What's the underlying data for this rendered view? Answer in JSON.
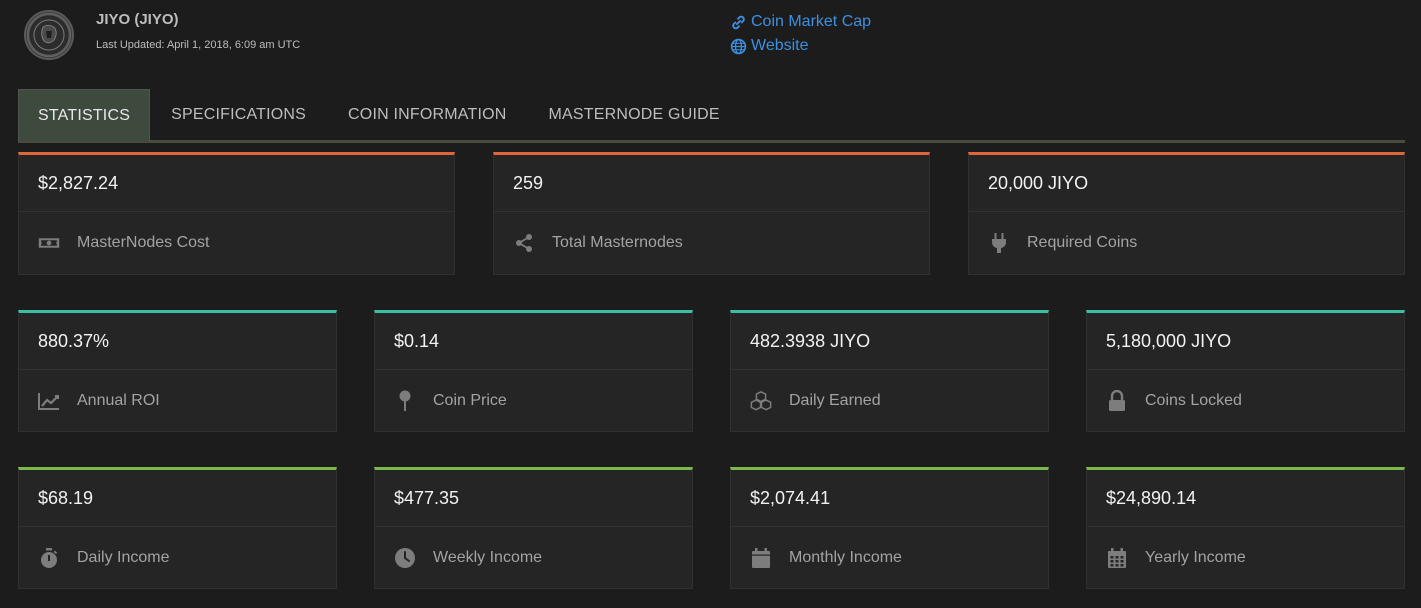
{
  "header": {
    "coin_title": "JIYO (JIYO)",
    "last_updated": "Last Updated: April 1, 2018, 6:09 am UTC",
    "links": [
      {
        "label": "Coin Market Cap",
        "icon": "link-icon"
      },
      {
        "label": "Website",
        "icon": "globe-icon"
      }
    ]
  },
  "tabs": [
    {
      "label": "STATISTICS",
      "active": true
    },
    {
      "label": "SPECIFICATIONS",
      "active": false
    },
    {
      "label": "COIN INFORMATION",
      "active": false
    },
    {
      "label": "MASTERNODE GUIDE",
      "active": false
    }
  ],
  "colors": {
    "row1_accent": "#e0663a",
    "row2_accent": "#3bbfa1",
    "row3_accent": "#7bb74a",
    "link": "#3d8fe0"
  },
  "stats": {
    "row1": [
      {
        "value": "$2,827.24",
        "label": "MasterNodes Cost",
        "icon": "money-icon"
      },
      {
        "value": "259",
        "label": "Total Masternodes",
        "icon": "share-icon"
      },
      {
        "value": "20,000 JIYO",
        "label": "Required Coins",
        "icon": "plug-icon"
      }
    ],
    "row2": [
      {
        "value": "880.37%",
        "label": "Annual ROI",
        "icon": "area-chart-icon"
      },
      {
        "value": "$0.14",
        "label": "Coin Price",
        "icon": "map-pin-icon"
      },
      {
        "value": "482.3938 JIYO",
        "label": "Daily Earned",
        "icon": "cubes-icon"
      },
      {
        "value": "5,180,000 JIYO",
        "label": "Coins Locked",
        "icon": "lock-icon"
      }
    ],
    "row3": [
      {
        "value": "$68.19",
        "label": "Daily Income",
        "icon": "stopwatch-icon"
      },
      {
        "value": "$477.35",
        "label": "Weekly Income",
        "icon": "clock-icon"
      },
      {
        "value": "$2,074.41",
        "label": "Monthly Income",
        "icon": "calendar-icon"
      },
      {
        "value": "$24,890.14",
        "label": "Yearly Income",
        "icon": "calendar-grid-icon"
      }
    ]
  }
}
